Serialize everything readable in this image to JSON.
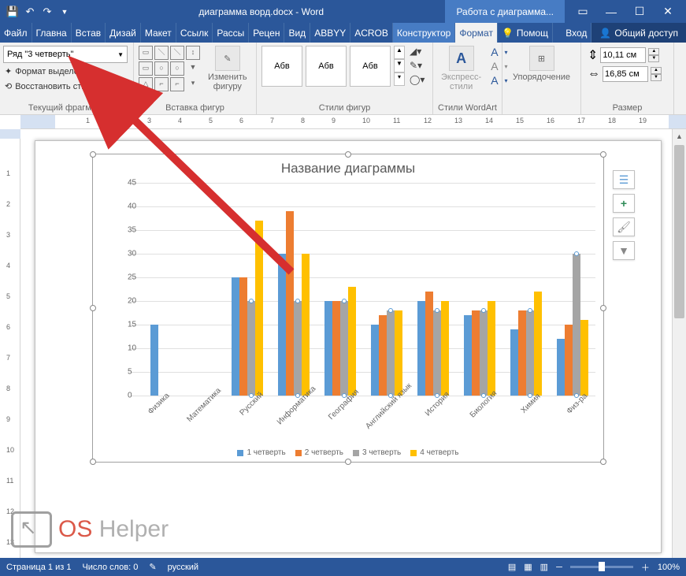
{
  "titlebar": {
    "doc_title": "диаграмма ворд.docx - Word",
    "chart_tools": "Работа с диаграмма..."
  },
  "tabs": {
    "file": "Файл",
    "items": [
      "Главна",
      "Встав",
      "Дизай",
      "Макет",
      "Ссылк",
      "Рассы",
      "Рецен",
      "Вид",
      "ABBYY",
      "ACROB"
    ],
    "sub": [
      "Конструктор",
      "Формат"
    ],
    "active": "Формат",
    "tell": "Помощ",
    "login": "Вход",
    "share": "Общий доступ"
  },
  "ribbon": {
    "selection": {
      "combo": "Ряд \"3 четверть\"",
      "format_sel": "Формат выделенного",
      "reset": "Восстановить стиль",
      "group": "Текущий фрагмент"
    },
    "shapes": {
      "change": "Изменить",
      "change2": "фигуру",
      "group": "Вставка фигур"
    },
    "styles": {
      "sample": "Абв",
      "group": "Стили фигур"
    },
    "wordart": {
      "express": "Экспресс-",
      "express2": "стили",
      "group": "Стили WordArt"
    },
    "arrange": {
      "label": "Упорядочение"
    },
    "size": {
      "h": "10,11 см",
      "w": "16,85 см",
      "group": "Размер"
    }
  },
  "chart_data": {
    "type": "bar",
    "title": "Название диаграммы",
    "ylim": [
      0,
      45
    ],
    "yticks": [
      0,
      5,
      10,
      15,
      20,
      25,
      30,
      35,
      40,
      45
    ],
    "categories": [
      "Физика",
      "Математика",
      "Русский",
      "Информатика",
      "География",
      "Английский язык",
      "История",
      "Биология",
      "Химия",
      "Физ-ра"
    ],
    "series": [
      {
        "name": "1 четверть",
        "color": "#5b9bd5",
        "values": [
          15,
          null,
          25,
          30,
          20,
          15,
          20,
          17,
          14,
          12
        ]
      },
      {
        "name": "2 четверть",
        "color": "#ed7d31",
        "values": [
          null,
          null,
          25,
          39,
          20,
          17,
          22,
          18,
          18,
          15
        ]
      },
      {
        "name": "3 четверть",
        "color": "#a5a5a5",
        "values": [
          null,
          null,
          20,
          20,
          20,
          18,
          18,
          18,
          18,
          30
        ],
        "selected": true
      },
      {
        "name": "4 четверть",
        "color": "#ffc000",
        "values": [
          null,
          null,
          37,
          30,
          23,
          18,
          20,
          20,
          22,
          16
        ]
      }
    ]
  },
  "status": {
    "page": "Страница 1 из 1",
    "words": "Число слов: 0",
    "lang": "русский",
    "zoom": "100%"
  },
  "watermark": {
    "p1": "OS",
    "p2": " Helper"
  }
}
